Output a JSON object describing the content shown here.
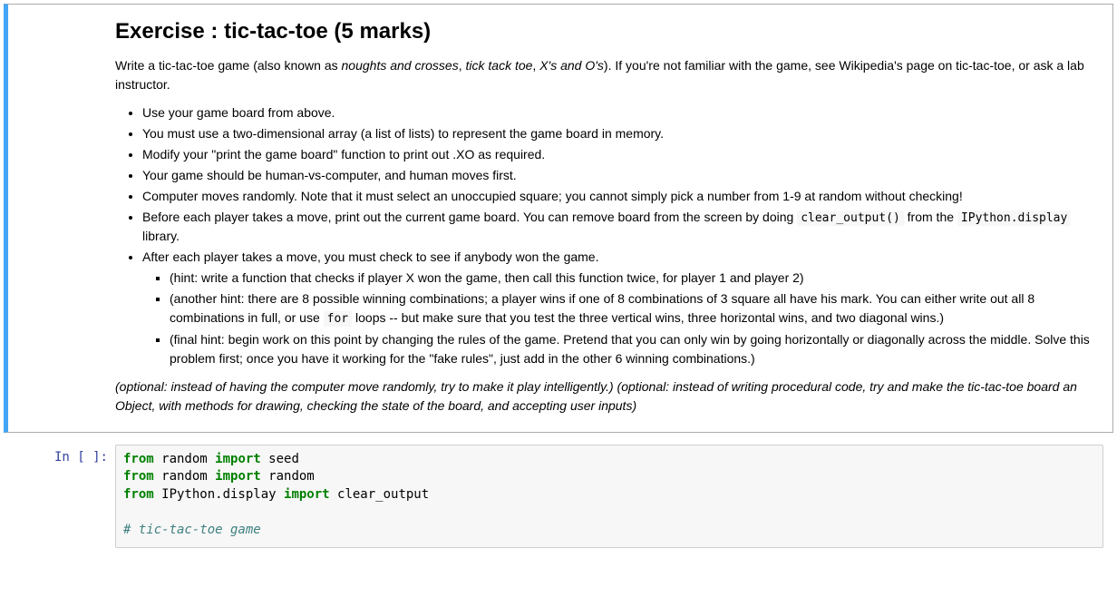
{
  "markdown": {
    "heading": "Exercise : tic-tac-toe (5 marks)",
    "intro_1": "Write a tic-tac-toe game (also known as ",
    "intro_em1": "noughts and crosses",
    "intro_2": ", ",
    "intro_em2": "tick tack toe",
    "intro_3": ", ",
    "intro_em3": "X's and O's",
    "intro_4": "). If you're not familiar with the game, see Wikipedia's page on tic-tac-toe, or ask a lab instructor.",
    "b1": "Use your game board from above.",
    "b2": "You must use a two-dimensional array (a list of lists) to represent the game board in memory.",
    "b3": "Modify your \"print the game board\" function to print out .XO as required.",
    "b4": "Your game should be human-vs-computer, and human moves first.",
    "b5": "Computer moves randomly. Note that it must select an unoccupied square; you cannot simply pick a number from 1-9 at random without checking!",
    "b6a": "Before each player takes a move, print out the current game board. You can remove board from the screen by doing ",
    "b6_code1": "clear_output()",
    "b6b": " from the ",
    "b6_code2": "IPython.display",
    "b6c": " library.",
    "b7": "After each player takes a move, you must check to see if anybody won the game.",
    "b7_1": "(hint: write a function that checks if player X won the game, then call this function twice, for player 1 and player 2)",
    "b7_2a": "(another hint: there are 8 possible winning combinations; a player wins if one of 8 combinations of 3 square all have his mark. You can either write out all 8 combinations in full, or use ",
    "b7_2_code": "for",
    "b7_2b": " loops -- but make sure that you test the three vertical wins, three horizontal wins, and two diagonal wins.)",
    "b7_3": "(final hint: begin work on this point by changing the rules of the game. Pretend that you can only win by going horizontally or diagonally across the middle. Solve this problem first; once you have it working for the \"fake rules\", just add in the other 6 winning combinations.)",
    "optional": "(optional: instead of having the computer move randomly, try to make it play intelligently.) (optional: instead of writing procedural code, try and make the tic-tac-toe board an Object, with methods for drawing, checking the state of the board, and accepting user inputs)"
  },
  "code": {
    "prompt": "In [ ]:",
    "kw_from": "from",
    "kw_import": "import",
    "l1_mod": " random ",
    "l1_name": " seed",
    "l2_mod": " random ",
    "l2_name": " random",
    "l3_mod": " IPython.display ",
    "l3_name": " clear_output",
    "comment": "# tic-tac-toe game"
  }
}
